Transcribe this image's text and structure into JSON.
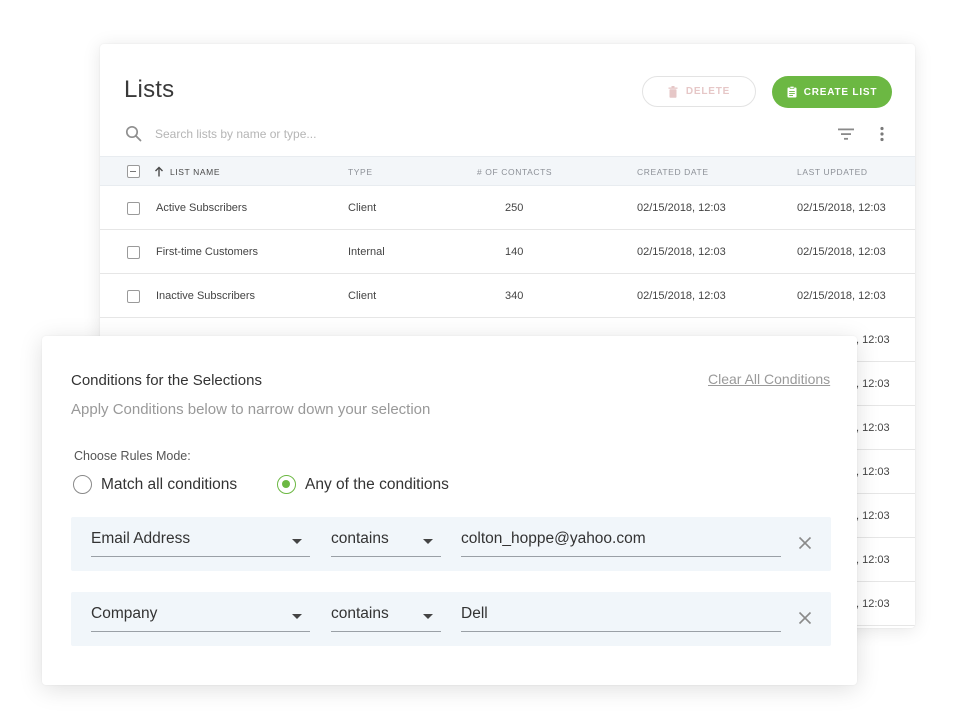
{
  "lists": {
    "title": "Lists",
    "delete_label": "DELETE",
    "create_label": "CREATE LIST",
    "search_placeholder": "Search lists by name or type...",
    "columns": {
      "name": "LIST NAME",
      "type": "TYPE",
      "contacts": "# OF CONTACTS",
      "created": "CREATED DATE",
      "updated": "LAST UPDATED"
    },
    "rows": [
      {
        "name": "Active Subscribers",
        "type": "Client",
        "contacts": "250",
        "created": "02/15/2018, 12:03",
        "updated": "02/15/2018, 12:03"
      },
      {
        "name": "First-time Customers",
        "type": "Internal",
        "contacts": "140",
        "created": "02/15/2018, 12:03",
        "updated": "02/15/2018, 12:03"
      },
      {
        "name": "Inactive Subscribers",
        "type": "Client",
        "contacts": "340",
        "created": "02/15/2018, 12:03",
        "updated": "02/15/2018, 12:03"
      }
    ],
    "partial_updated": ", 12:03"
  },
  "conditions": {
    "title": "Conditions for the Selections",
    "subtitle": "Apply Conditions below to narrow down your selection",
    "clear_all": "Clear All Conditions",
    "rules_mode_label": "Choose Rules Mode:",
    "mode_options": [
      {
        "label": "Match all conditions",
        "selected": false
      },
      {
        "label": "Any of the conditions",
        "selected": true
      }
    ],
    "rules": [
      {
        "field": "Email Address",
        "operator": "contains",
        "value": "colton_hoppe@yahoo.com"
      },
      {
        "field": "Company",
        "operator": "contains",
        "value": "Dell"
      }
    ]
  },
  "colors": {
    "accent": "#6cb843",
    "table_header_bg": "#f3f6f9",
    "condition_row_bg": "#f1f6fa"
  }
}
